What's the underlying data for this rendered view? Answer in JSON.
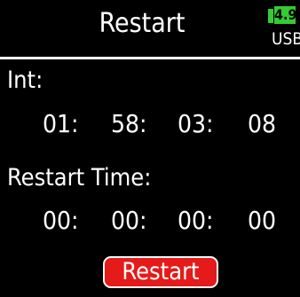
{
  "header": {
    "title": "Restart",
    "battery_level": "4.9",
    "power_source": "USB"
  },
  "int": {
    "label": "Int:",
    "hh": "01:",
    "mm": "58:",
    "ss": "03:",
    "ff": "08"
  },
  "restart_time": {
    "label": "Restart Time:",
    "hh": "00:",
    "mm": "00:",
    "ss": "00:",
    "ff": "00"
  },
  "button": {
    "label": "Restart"
  },
  "colors": {
    "battery": "#33cc33",
    "button": "#e51a1a"
  }
}
